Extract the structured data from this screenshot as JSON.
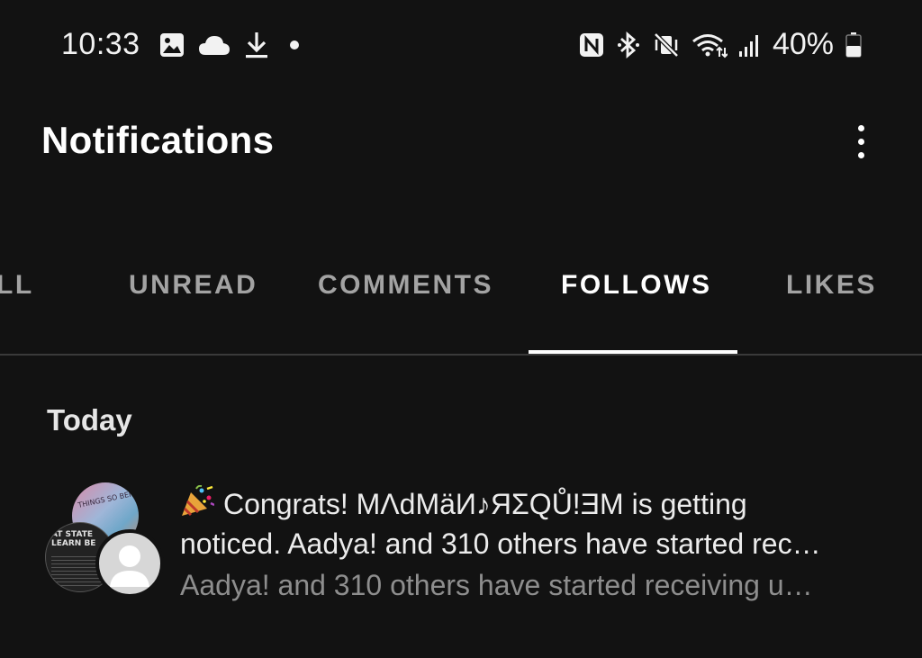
{
  "status_bar": {
    "time": "10:33",
    "left_icons": [
      "image-icon",
      "cloud-icon",
      "download-icon",
      "dot-icon"
    ],
    "right_icons": [
      "nfc-icon",
      "bluetooth-icon",
      "vibrate-mute-icon",
      "wifi-icon",
      "signal-icon"
    ],
    "battery_percent": "40%"
  },
  "header": {
    "title": "Notifications",
    "more_icon": "more-vert-icon"
  },
  "tabs": [
    {
      "label": "LL",
      "active": false
    },
    {
      "label": "UNREAD",
      "active": false
    },
    {
      "label": "COMMENTS",
      "active": false
    },
    {
      "label": "FOLLOWS",
      "active": true
    },
    {
      "label": "LIKES",
      "active": false
    }
  ],
  "section": {
    "title": "Today"
  },
  "notification": {
    "icon": "party-popper-icon",
    "line1": "Congrats! MΛdMäИ♪ЯΣQŮ!ƎM is getting",
    "line2": "noticed. Aadya! and 310 others have started rec…",
    "line3": "Aadya! and 310 others have started receiving u…",
    "avatar_text_1": "THINGS SO BEI...",
    "avatar_text_2": "AT STATE LEARN BE"
  },
  "colors": {
    "background": "#121212",
    "active_tab": "#ffffff",
    "inactive_tab": "#a3a3a3",
    "secondary_text": "#8e8e8e"
  }
}
